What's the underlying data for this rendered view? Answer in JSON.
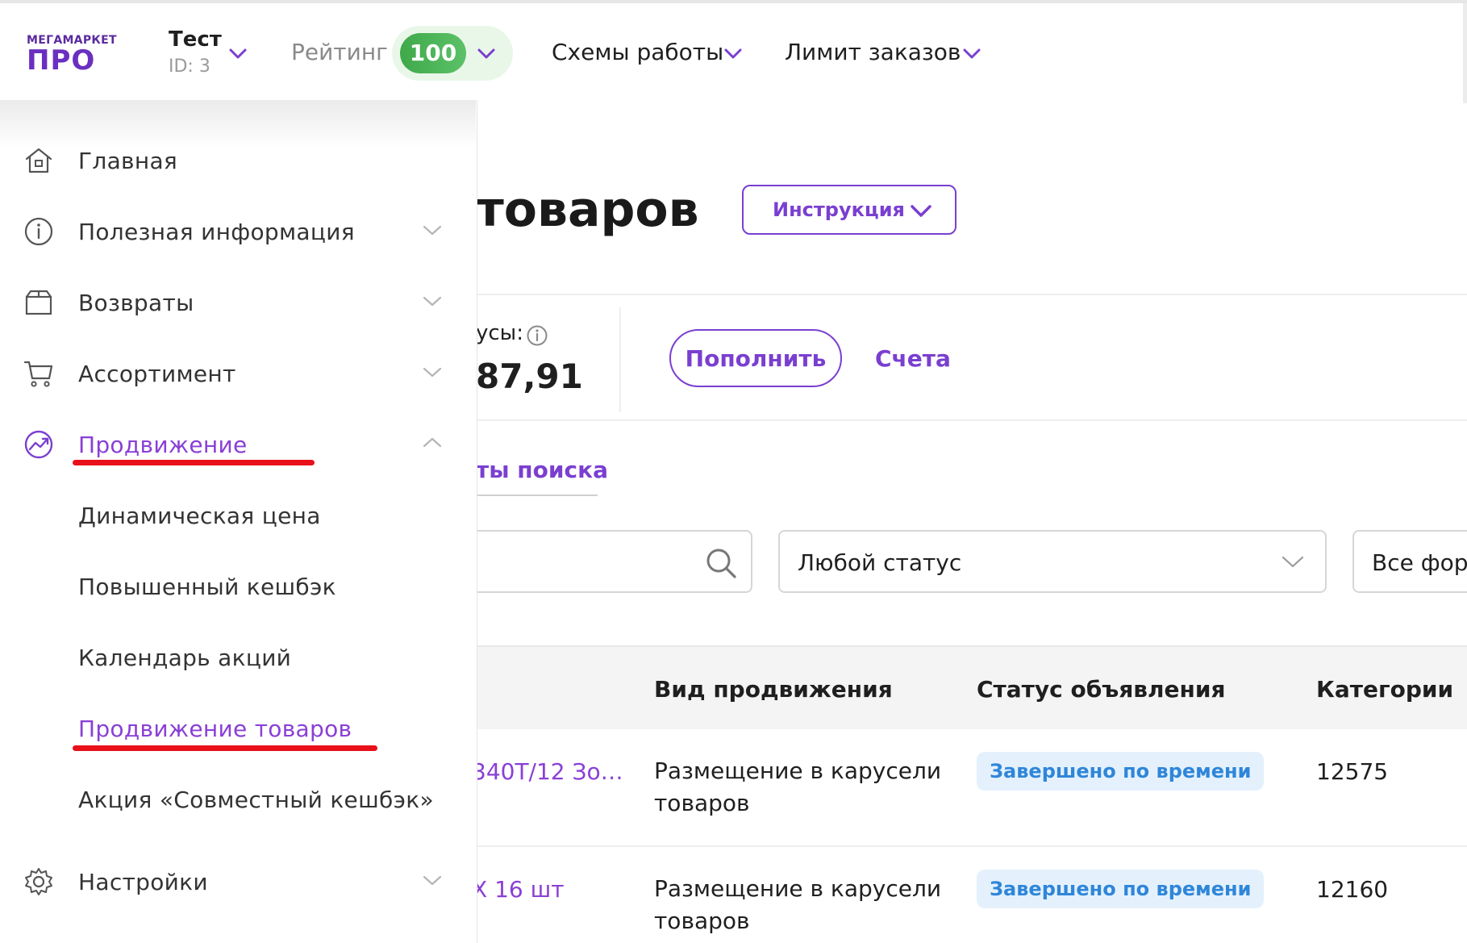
{
  "header": {
    "logo_top": "МЕГАМАРКЕТ",
    "logo_bottom": "ПРО",
    "store_name": "Тест",
    "store_id": "ID: 3",
    "rating_label": "Рейтинг",
    "rating_value": "100",
    "nav": [
      "Схемы работы",
      "Лимит заказов"
    ]
  },
  "sidebar": {
    "items": [
      {
        "label": "Главная",
        "icon": "home-icon"
      },
      {
        "label": "Полезная информация",
        "icon": "info-icon"
      },
      {
        "label": "Возвраты",
        "icon": "box-icon"
      },
      {
        "label": "Ассортимент",
        "icon": "cart-icon"
      },
      {
        "label": "Продвижение",
        "icon": "promotion-chart-icon"
      },
      {
        "label": "Настройки",
        "icon": "gear-icon"
      }
    ],
    "promotion_subitems": [
      "Динамическая цена",
      "Повышенный кешбэк",
      "Календарь акций",
      "Продвижение товаров",
      "Акция «Совместный кешбэк»"
    ]
  },
  "main": {
    "title_visible": "товаров",
    "instruction_button": "Инструкция",
    "balance_label": "усы:",
    "balance_value": "87,91",
    "topup_button": "Пополнить",
    "accounts_link": "Счета",
    "tab_label": "ты поиска",
    "status_select": "Любой статус",
    "format_select": "Все фор",
    "table": {
      "headers": [
        "Вид продвижения",
        "Статус объявления",
        "Категории"
      ],
      "rows": [
        {
          "name": "340Т/12 Зо…",
          "type_line1": "Размещение в карусели",
          "type_line2": "товаров",
          "status": "Завершено по времени",
          "category": "12575"
        },
        {
          "name": "Х 16 шт",
          "type_line1": "Размещение в карусели",
          "type_line2": "товаров",
          "status": "Завершено по времени",
          "category": "12160"
        }
      ]
    }
  },
  "colors": {
    "accent": "#7a3fd0",
    "active_link": "#8a3fd6",
    "rating_green": "#4caf50",
    "badge_bg": "#e4f1fd",
    "badge_text": "#2f86d9",
    "annotation_red": "#e8101a"
  }
}
